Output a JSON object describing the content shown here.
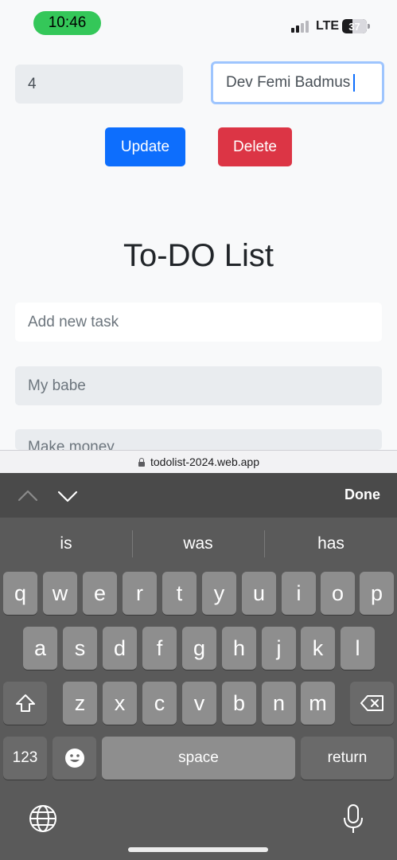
{
  "status_bar": {
    "time": "10:46",
    "network": "LTE",
    "battery": "37"
  },
  "form": {
    "id_value": "4",
    "name_value": "Dev Femi Badmus",
    "update_label": "Update",
    "delete_label": "Delete"
  },
  "page": {
    "title": "To-DO List",
    "new_task_placeholder": "Add new task",
    "tasks": [
      "My babe",
      "Make money"
    ]
  },
  "browser": {
    "url": "todolist-2024.web.app"
  },
  "keyboard": {
    "done_label": "Done",
    "suggestions": [
      "is",
      "was",
      "has"
    ],
    "row1": [
      "q",
      "w",
      "e",
      "r",
      "t",
      "y",
      "u",
      "i",
      "o",
      "p"
    ],
    "row2": [
      "a",
      "s",
      "d",
      "f",
      "g",
      "h",
      "j",
      "k",
      "l"
    ],
    "row3": [
      "z",
      "x",
      "c",
      "v",
      "b",
      "n",
      "m"
    ],
    "numbers_label": "123",
    "space_label": "space",
    "return_label": "return",
    "icons": [
      "chevron-up-icon",
      "chevron-down-icon",
      "shift-icon",
      "backspace-icon",
      "emoji-icon",
      "globe-icon",
      "microphone-icon"
    ]
  },
  "colors": {
    "primary": "#0d6efd",
    "danger": "#dc3545",
    "status_pill": "#34c759",
    "keyboard_bg": "#5a5a5a"
  }
}
